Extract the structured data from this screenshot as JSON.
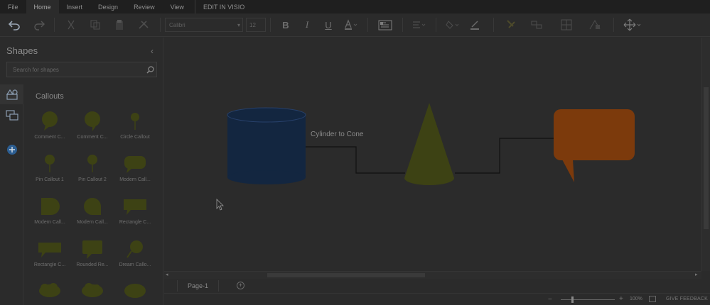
{
  "menu": {
    "items": [
      "File",
      "Home",
      "Insert",
      "Design",
      "Review",
      "View"
    ],
    "edit_in_visio": "EDIT IN VISIO"
  },
  "toolbar": {
    "font_name": "Calibri",
    "font_size": "12"
  },
  "sidebar": {
    "title": "Shapes",
    "search_placeholder": "Search for shapes",
    "category_title": "Callouts",
    "shapes": [
      "Comment C...",
      "Comment C...",
      "Circle Callout",
      "Pin Callout 1",
      "Pin Callout 2",
      "Modern Call...",
      "Modern Call...",
      "Modern Call...",
      "Rectangle C...",
      "Rectangle C...",
      "Rounded Re...",
      "Dream Callo...",
      "",
      "",
      ""
    ]
  },
  "canvas": {
    "connector_label": "Cylinder to Cone",
    "colors": {
      "cylinder": "#132640",
      "cone": "#3d4214",
      "callout": "#7c3a0c",
      "connector": "#111111"
    }
  },
  "pages": {
    "tab": "Page-1"
  },
  "status": {
    "zoom": "100%",
    "feedback": "GIVE FEEDBACK"
  }
}
